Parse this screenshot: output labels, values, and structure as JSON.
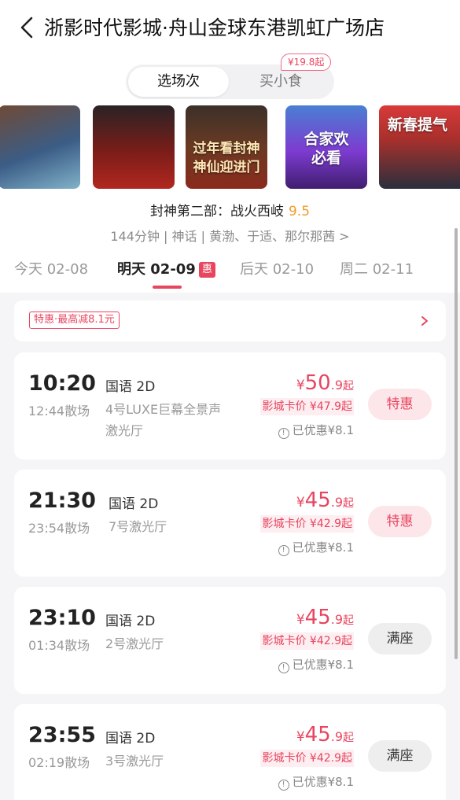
{
  "header": {
    "title": "浙影时代影城·舟山金球东港凯虹广场店"
  },
  "segment": {
    "active": "选场次",
    "other": "买小食",
    "badge": "¥19.8起"
  },
  "posters": [
    {
      "text": ""
    },
    {
      "text": ""
    },
    {
      "line1": "过年看封神",
      "line2": "神仙迎进门"
    },
    {
      "line1": "合家欢",
      "line2": "必看"
    },
    {
      "line1": "新春提气",
      "line2": ""
    }
  ],
  "movie": {
    "name": "封神第二部：战火西岐",
    "score": "9.5",
    "meta": "144分钟 | 神话 | 黄渤、于适、那尔那茜 >"
  },
  "date_tabs": [
    {
      "label": "今天 02-08"
    },
    {
      "label": "明天 02-09",
      "badge": "惠"
    },
    {
      "label": "后天 02-10"
    },
    {
      "label": "周二 02-11"
    }
  ],
  "promo": {
    "tag": "特惠·最高减8.1元"
  },
  "showtimes": [
    {
      "start": "10:20",
      "end": "12:44散场",
      "lang": "国语 2D",
      "hall": "4号LUXE巨幕全景声激光厅",
      "yen": "¥",
      "price_int": "50",
      "price_dec": ".9",
      "price_suffix": "起",
      "card_price": "影城卡价 ¥47.9起",
      "saved": "已优惠¥8.1",
      "button": "特惠",
      "button_type": "deal"
    },
    {
      "start": "21:30",
      "end": "23:54散场",
      "lang": "国语 2D",
      "hall": "7号激光厅",
      "yen": "¥",
      "price_int": "45",
      "price_dec": ".9",
      "price_suffix": "起",
      "card_price": "影城卡价 ¥42.9起",
      "saved": "已优惠¥8.1",
      "button": "特惠",
      "button_type": "deal"
    },
    {
      "start": "23:10",
      "end": "01:34散场",
      "lang": "国语 2D",
      "hall": "2号激光厅",
      "yen": "¥",
      "price_int": "45",
      "price_dec": ".9",
      "price_suffix": "起",
      "card_price": "影城卡价 ¥42.9起",
      "saved": "已优惠¥8.1",
      "button": "满座",
      "button_type": "full"
    },
    {
      "start": "23:55",
      "end": "02:19散场",
      "lang": "国语 2D",
      "hall": "3号激光厅",
      "yen": "¥",
      "price_int": "45",
      "price_dec": ".9",
      "price_suffix": "起",
      "card_price": "影城卡价 ¥42.9起",
      "saved": "已优惠¥8.1",
      "button": "满座",
      "button_type": "full"
    }
  ],
  "colors": {
    "accent": "#e8455f",
    "score": "#f39c2a",
    "list_bg": "#f5f5f7"
  },
  "icons": {
    "back": "chevron-left-icon",
    "info": "info-circle-icon",
    "arrow": "chevron-right-icon"
  }
}
